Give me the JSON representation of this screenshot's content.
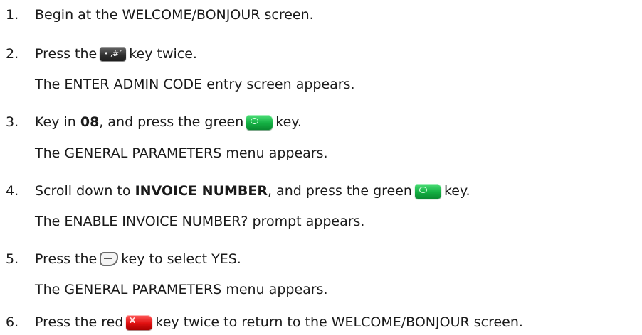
{
  "steps": [
    {
      "number": "1.",
      "before": "Begin at the WELCOME/BONJOUR screen."
    },
    {
      "number": "2.",
      "before": "Press the",
      "key": "hash-key-icon",
      "key_label": "• ,#´",
      "after": "key twice.",
      "result": "The ENTER ADMIN CODE entry screen appears."
    },
    {
      "number": "3.",
      "before": "Key in",
      "bold": "08",
      "middle": ", and press the green",
      "key": "green-key-icon",
      "after": "key.",
      "result": "The GENERAL PARAMETERS menu appears."
    },
    {
      "number": "4.",
      "before": "Scroll down to",
      "bold": "INVOICE NUMBER",
      "middle": ", and press the green",
      "key": "green-key-icon",
      "after": "key.",
      "result": "The ENABLE INVOICE NUMBER? prompt appears."
    },
    {
      "number": "5.",
      "before": "Press the",
      "key": "soft-key-icon",
      "after": "key to select YES.",
      "result": "The GENERAL PARAMETERS menu appears."
    },
    {
      "number": "6.",
      "before": "Press the red",
      "key": "red-key-icon",
      "after": "key twice to return to the WELCOME/BONJOUR screen."
    }
  ],
  "colors": {
    "green_key": "#14b043",
    "red_key": "#e01010",
    "hash_key": "#2e2e2e"
  }
}
